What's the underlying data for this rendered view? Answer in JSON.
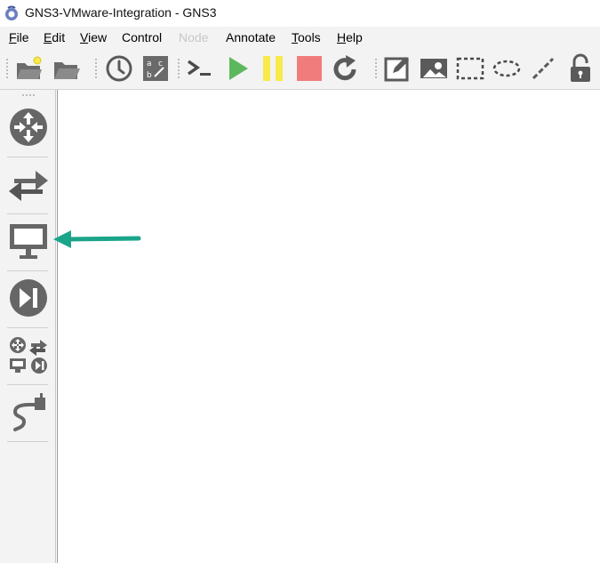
{
  "window": {
    "title": "GNS3-VMware-Integration - GNS3"
  },
  "menu": [
    {
      "label": "File",
      "accel": "F",
      "rest": "ile",
      "enabled": true
    },
    {
      "label": "Edit",
      "accel": "E",
      "rest": "dit",
      "enabled": true
    },
    {
      "label": "View",
      "accel": "V",
      "rest": "iew",
      "enabled": true
    },
    {
      "label": "Control",
      "accel": "",
      "rest": "Control",
      "enabled": true
    },
    {
      "label": "Node",
      "accel": "",
      "rest": "Node",
      "enabled": false
    },
    {
      "label": "Annotate",
      "accel": "",
      "rest": "Annotate",
      "enabled": true
    },
    {
      "label": "Tools",
      "accel": "T",
      "rest": "ools",
      "enabled": true
    },
    {
      "label": "Help",
      "accel": "H",
      "rest": "elp",
      "enabled": true
    }
  ],
  "toolbar": {
    "icons": [
      "new-project-icon",
      "open-project-icon",
      "snapshot-clock-icon",
      "show-interface-labels-icon",
      "console-all-icon",
      "start-all-icon",
      "suspend-all-icon",
      "stop-all-icon",
      "reload-all-icon",
      "add-note-icon",
      "insert-image-icon",
      "draw-rectangle-icon",
      "draw-ellipse-icon",
      "draw-line-icon",
      "lock-icon"
    ]
  },
  "dock": {
    "items": [
      "routers-icon",
      "switches-icon",
      "end-devices-icon",
      "security-devices-icon",
      "all-devices-icon",
      "add-link-icon"
    ]
  },
  "colors": {
    "start_green": "#5cb85c",
    "pause_yellow": "#f7ea4a",
    "stop_red": "#f07c7c",
    "icon_gray": "#5a5a5a",
    "arrow_teal": "#1aa58a"
  }
}
